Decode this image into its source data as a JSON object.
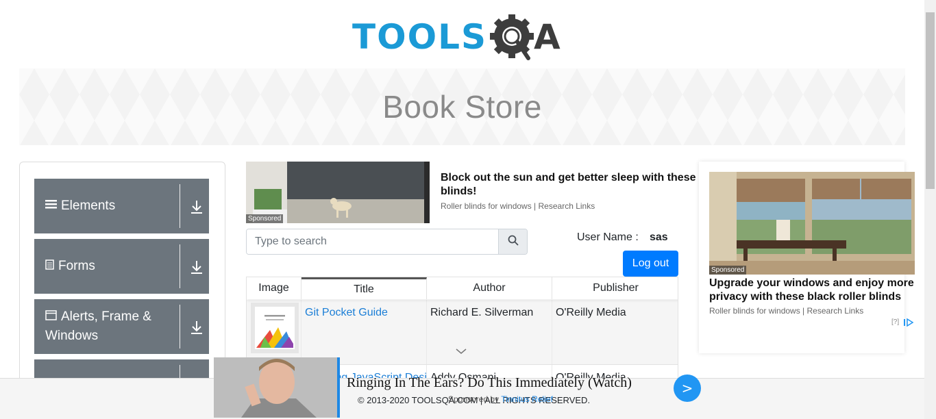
{
  "brand": {
    "logo_text": "TOOLS",
    "logo_suffix": "A"
  },
  "banner": {
    "title": "Book Store"
  },
  "menu": {
    "groups": [
      {
        "label": "Elements",
        "icon": "hamburger-icon"
      },
      {
        "label": "Forms",
        "icon": "form-icon"
      },
      {
        "label": "Alerts, Frame & Windows",
        "icon": "window-icon"
      }
    ]
  },
  "ad_top": {
    "title": "Block out the sun and get better sleep with these blinds!",
    "subtitle": "Roller blinds for windows | Research Links",
    "badge": "Sponsored"
  },
  "search": {
    "placeholder": "Type to search",
    "icon": "search-icon"
  },
  "user": {
    "label": "User Name :",
    "value": "sas",
    "logout_label": "Log out"
  },
  "table": {
    "headers": [
      "Image",
      "Title",
      "Author",
      "Publisher"
    ],
    "rows": [
      {
        "title": "Git Pocket Guide",
        "author": "Richard E. Silverman",
        "publisher": "O'Reilly Media"
      },
      {
        "title": "Learning JavaScript Design Patterns",
        "author": "Addy Osmani",
        "publisher": "O'Reilly Media"
      }
    ]
  },
  "ad_right": {
    "title": "Upgrade your windows and enjoy more privacy with these black roller blinds",
    "subtitle": "Roller blinds for windows | Research Links",
    "badge": "Sponsored",
    "help": "[?]"
  },
  "footer": {
    "copyright": "© 2013-2020 TOOLSQA.COM | ALL RIGHTS RESERVED."
  },
  "bottom_ad": {
    "title": "Ringing In The Ears? Do This Immediately (Watch)",
    "source_prefix": "Sponsored by",
    "source_name": "Tinnitus Relief",
    "go_label": ">"
  },
  "colors": {
    "accent": "#007bff",
    "menu_bg": "#6c757d",
    "logo_blue": "#1b9ad6",
    "logo_dark": "#3d3d3d"
  }
}
